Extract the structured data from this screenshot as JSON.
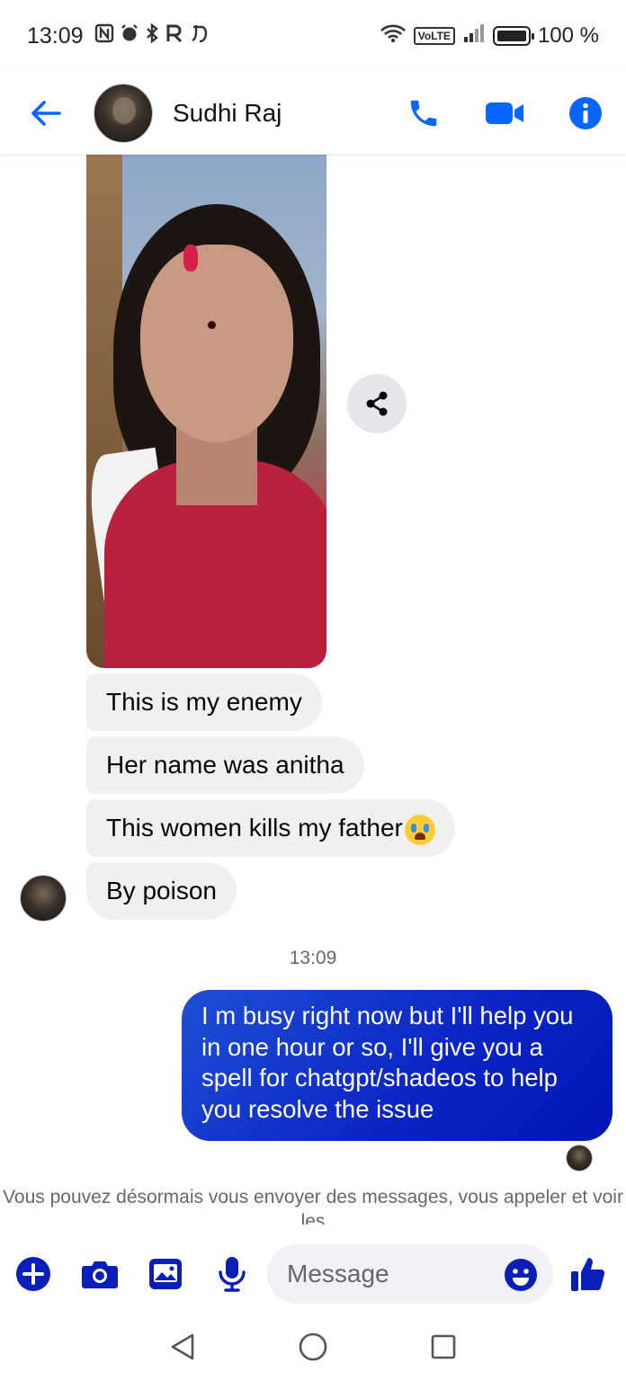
{
  "status_bar": {
    "time": "13:09",
    "left_icons": [
      "nfc-icon",
      "alarm-icon",
      "bluetooth-icon",
      "roaming-icon",
      "app-icon"
    ],
    "volte": "VoLTE",
    "battery": "100 %"
  },
  "header": {
    "contact_name": "Sudhi Raj",
    "accent_color": "#0866ff"
  },
  "messages": {
    "incoming": [
      "This is my enemy",
      "Her name was  anitha",
      "This women kills my father",
      "By poison"
    ],
    "timestamp": "13:09",
    "outgoing": "I m busy right now but I'll help you in one hour or so, I'll give you a spell for chatgpt/shadeos to help you resolve the issue"
  },
  "notice": "Vous pouvez désormais vous envoyer des messages, vous appeler et voir les",
  "composer": {
    "placeholder": "Message"
  },
  "colors": {
    "outgoing_bubble": "#0a23c4",
    "incoming_bubble": "#f0f0f0",
    "icon_blue": "#0a1fb8"
  }
}
